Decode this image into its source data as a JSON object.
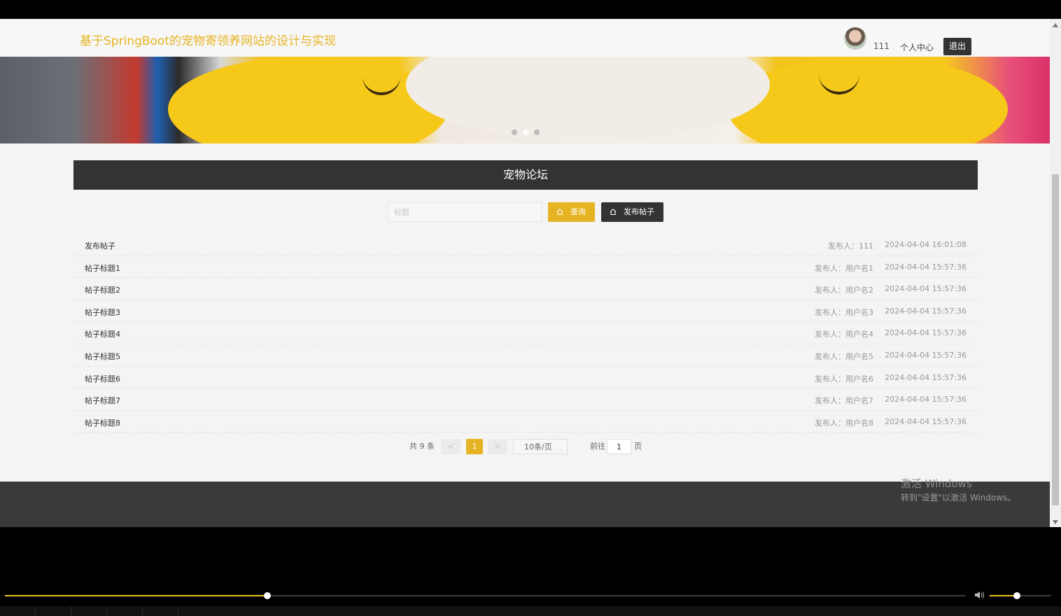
{
  "header": {
    "site_title": "基于SpringBoot的宠物寄领养网站的设计与实现",
    "username": "111",
    "personal_center": "个人中心",
    "logout": "退出"
  },
  "banner": {
    "slide_count": 3,
    "active_slide": 2
  },
  "forum": {
    "title": "宠物论坛",
    "search_placeholder": "标题",
    "search_button": "查询",
    "post_button": "发布帖子",
    "posts": [
      {
        "title": "发布帖子",
        "author": "发布人：111",
        "date": "2024-04-04 16:01:08"
      },
      {
        "title": "帖子标题1",
        "author": "发布人：用户名1",
        "date": "2024-04-04 15:57:36"
      },
      {
        "title": "帖子标题2",
        "author": "发布人：用户名2",
        "date": "2024-04-04 15:57:36"
      },
      {
        "title": "帖子标题3",
        "author": "发布人：用户名3",
        "date": "2024-04-04 15:57:36"
      },
      {
        "title": "帖子标题4",
        "author": "发布人：用户名4",
        "date": "2024-04-04 15:57:36"
      },
      {
        "title": "帖子标题5",
        "author": "发布人：用户名5",
        "date": "2024-04-04 15:57:36"
      },
      {
        "title": "帖子标题6",
        "author": "发布人：用户名6",
        "date": "2024-04-04 15:57:36"
      },
      {
        "title": "帖子标题7",
        "author": "发布人：用户名7",
        "date": "2024-04-04 15:57:36"
      },
      {
        "title": "帖子标题8",
        "author": "发布人：用户名8",
        "date": "2024-04-04 15:57:36"
      }
    ]
  },
  "pagination": {
    "total": "共 9 条",
    "prev": "<",
    "current": "1",
    "next": ">",
    "page_size": "10条/页",
    "goto_label": "前往",
    "goto_value": "1",
    "page_suffix": "页"
  },
  "watermark": {
    "line1": "激活 Windows",
    "line2": "转到\"设置\"以激活 Windows。"
  },
  "player": {
    "progress_fraction": 0.273,
    "volume_fraction": 0.44,
    "accent_color": "#f0c419"
  },
  "colors": {
    "accent": "#e6b422",
    "dark": "#333333"
  }
}
